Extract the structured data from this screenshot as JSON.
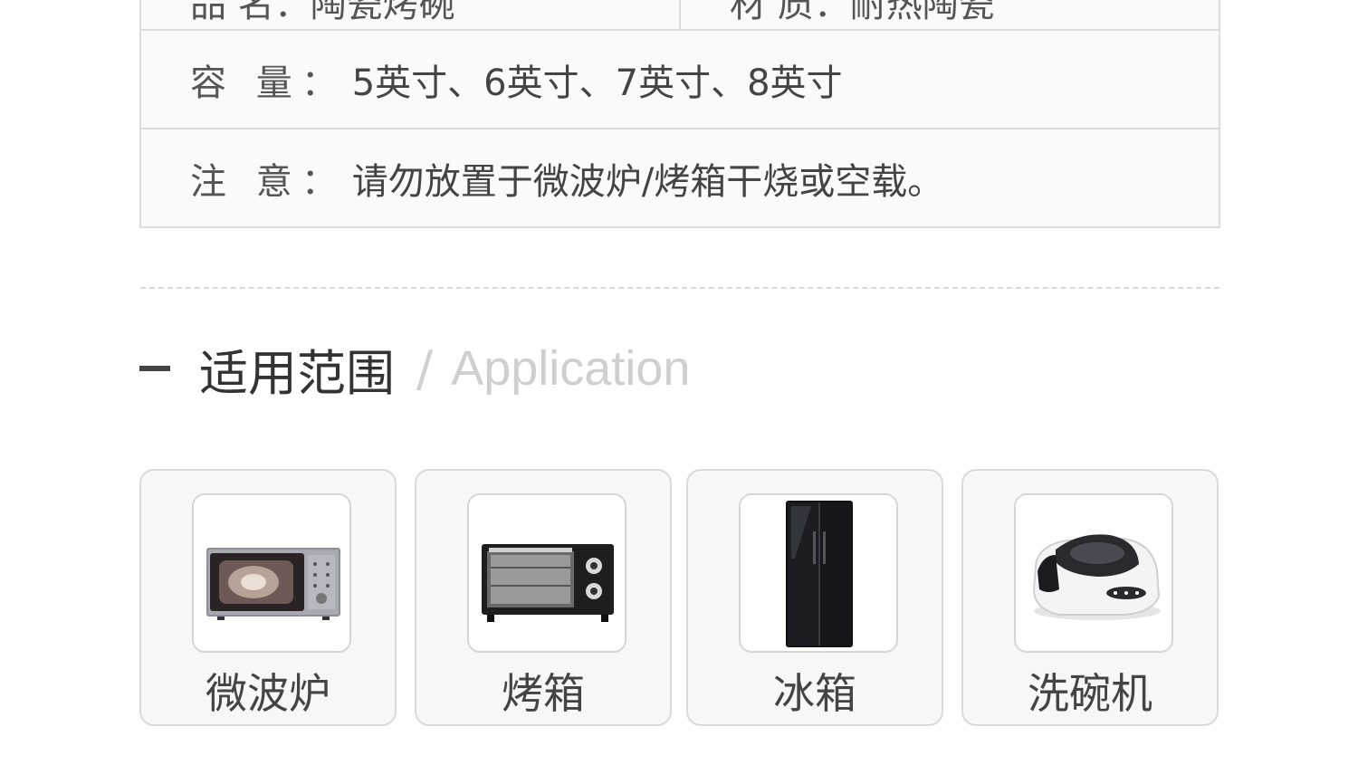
{
  "specs": {
    "top_row_left": "品 名：陶瓷烤碗",
    "top_row_right": "材 质：耐热陶瓷",
    "rows": [
      {
        "label": "容 量：",
        "value": "5英寸、6英寸、7英寸、8英寸"
      },
      {
        "label": "注 意：",
        "value": "请勿放置于微波炉/烤箱干烧或空载。"
      }
    ]
  },
  "section": {
    "title_cn": "适用范围",
    "separator": "/",
    "title_en": "Application"
  },
  "appliances": [
    {
      "name": "微波炉",
      "icon": "microwave-icon"
    },
    {
      "name": "烤箱",
      "icon": "oven-icon"
    },
    {
      "name": "冰箱",
      "icon": "fridge-icon"
    },
    {
      "name": "洗碗机",
      "icon": "dishwasher-icon"
    }
  ]
}
